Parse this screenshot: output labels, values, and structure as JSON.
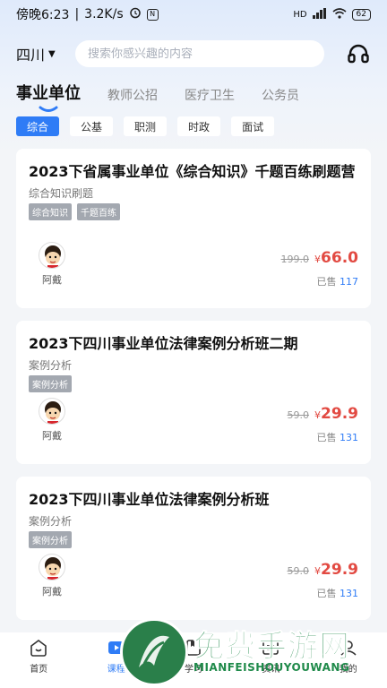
{
  "status_bar": {
    "time": "傍晚6:23",
    "speed": "3.2K/s",
    "signal": "HD",
    "battery": "62"
  },
  "header": {
    "region": "四川",
    "search_placeholder": "搜索你感兴趣的内容"
  },
  "category_tabs": [
    {
      "label": "事业单位",
      "active": true
    },
    {
      "label": "教师公招",
      "active": false
    },
    {
      "label": "医疗卫生",
      "active": false
    },
    {
      "label": "公务员",
      "active": false
    }
  ],
  "sub_tabs": [
    {
      "label": "综合",
      "active": true
    },
    {
      "label": "公基",
      "active": false
    },
    {
      "label": "职测",
      "active": false
    },
    {
      "label": "时政",
      "active": false
    },
    {
      "label": "面试",
      "active": false
    }
  ],
  "courses": [
    {
      "title": "2023下省属事业单位《综合知识》千题百练刷题营",
      "subtitle": "综合知识刷题",
      "tags": [
        "综合知识",
        "千题百练"
      ],
      "teacher": "阿戴",
      "original_price": "199.0",
      "currency": "¥",
      "price": "66.0",
      "sold_label": "已售",
      "sold_count": "117"
    },
    {
      "title": "2023下四川事业单位法律案例分析班二期",
      "subtitle": "案例分析",
      "tags": [
        "案例分析"
      ],
      "teacher": "阿戴",
      "original_price": "59.0",
      "currency": "¥",
      "price": "29.9",
      "sold_label": "已售",
      "sold_count": "131"
    },
    {
      "title": "2023下四川事业单位法律案例分析班",
      "subtitle": "案例分析",
      "tags": [
        "案例分析"
      ],
      "teacher": "阿戴",
      "original_price": "59.0",
      "currency": "¥",
      "price": "29.9",
      "sold_label": "已售",
      "sold_count": "131"
    }
  ],
  "bottom_nav": [
    {
      "label": "首页",
      "icon": "home-icon",
      "active": false
    },
    {
      "label": "课程",
      "icon": "play-icon",
      "active": true
    },
    {
      "label": "学习",
      "icon": "book-icon",
      "active": false
    },
    {
      "label": "资讯",
      "icon": "news-icon",
      "active": false
    },
    {
      "label": "我的",
      "icon": "user-icon",
      "active": false
    }
  ],
  "watermark": {
    "title": "免费手游网",
    "subtitle": "MIANFEISHOUYOUWANG"
  },
  "colors": {
    "accent": "#2f7cf6",
    "price": "#e24a42",
    "tag_bg": "#a3a8b0",
    "watermark_green": "#1f8a4a"
  }
}
